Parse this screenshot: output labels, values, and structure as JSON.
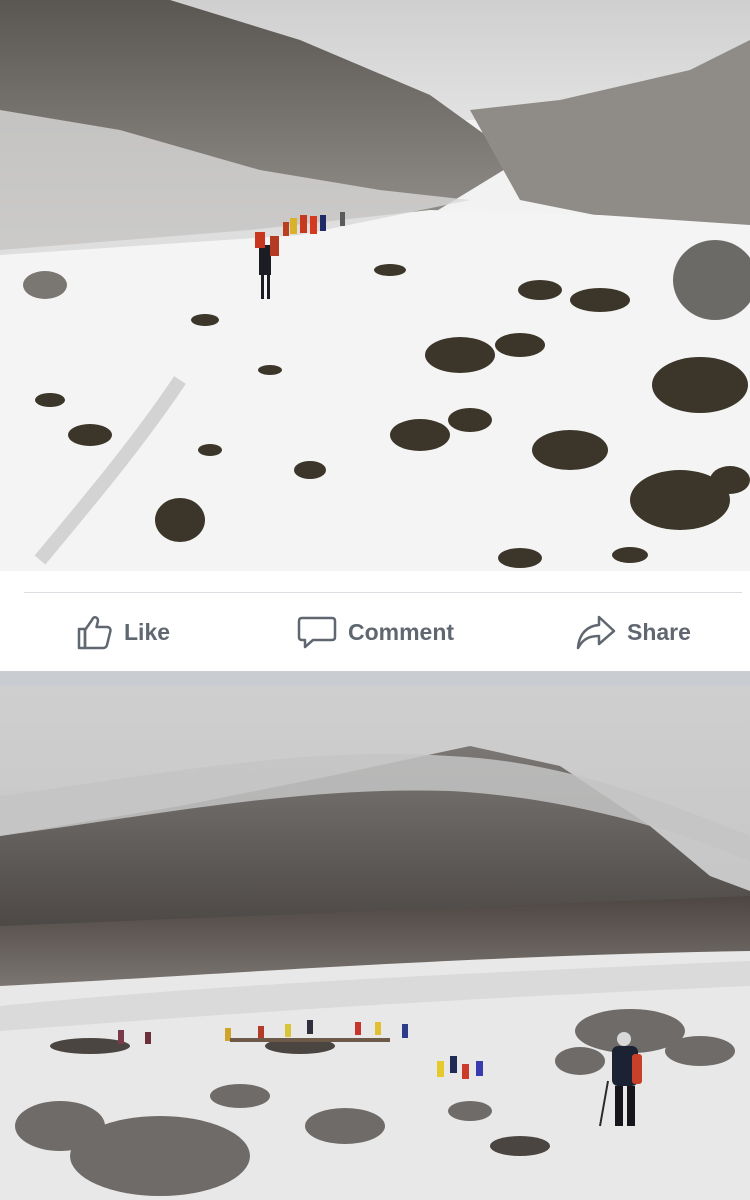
{
  "actions": {
    "like_label": "Like",
    "comment_label": "Comment",
    "share_label": "Share",
    "like_icon": "thumbs-up-icon",
    "comment_icon": "speech-bubble-icon",
    "share_icon": "share-arrow-icon"
  },
  "colors": {
    "action_text": "#606770",
    "divider": "#dadde1",
    "separator": "#c9ccd1"
  }
}
